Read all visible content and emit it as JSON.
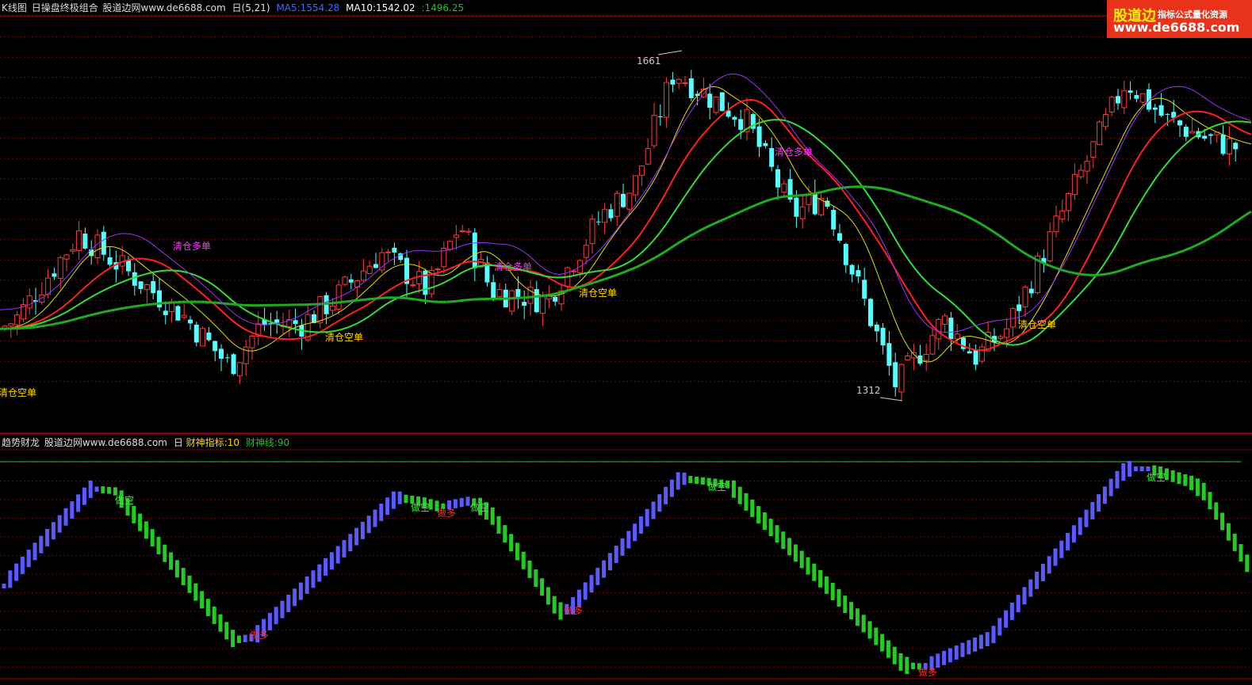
{
  "main_panel": {
    "title": "K线图",
    "formula_name": "日操盘终极组合",
    "site_text": "股道边网www.de6688.com",
    "period": "日(5,21)",
    "ma5_text": "MA5:1554.28",
    "ma10_text": "MA10:1542.02",
    "ma_long_text": ":1496.25",
    "colors": {
      "ma5": "#3a6bff",
      "ma10": "#ffffff",
      "ma_long": "#22c022",
      "bull": "#ff3a3a",
      "bear": "#54ffff",
      "grid": "#7a0000"
    },
    "high_label": "1661",
    "low_label": "1312",
    "labels": [
      {
        "text": "清仓空单",
        "color": "#ffd800",
        "id": "a1"
      },
      {
        "text": "清仓多单",
        "color": "#ff33ff",
        "id": "a2"
      },
      {
        "text": "清仓空单",
        "color": "#ffd800",
        "id": "a3"
      },
      {
        "text": "清仓多单",
        "color": "#ff33ff",
        "id": "a4"
      },
      {
        "text": "清仓空单",
        "color": "#ffd800",
        "id": "a5"
      },
      {
        "text": "清仓多单",
        "color": "#ff33ff",
        "id": "a6"
      },
      {
        "text": "清仓空单",
        "color": "#ffd800",
        "id": "a7"
      }
    ]
  },
  "sub_panel": {
    "title": "趋势财龙",
    "site_text": "股道边网www.de6688.com",
    "period": "日",
    "indicator_text": "财神指标:10",
    "line_text": "财神线:90",
    "signals": [
      {
        "text": "做空",
        "type": "short"
      },
      {
        "text": "做多",
        "type": "long"
      },
      {
        "text": "做空",
        "type": "short"
      },
      {
        "text": "做多",
        "type": "long"
      },
      {
        "text": "做空",
        "type": "short"
      },
      {
        "text": "做多",
        "type": "long"
      },
      {
        "text": "做空",
        "type": "short"
      },
      {
        "text": "做多",
        "type": "long"
      },
      {
        "text": "做空",
        "type": "short"
      }
    ]
  },
  "logo": {
    "brand": "股道边",
    "tagline": "指标公式量化资源",
    "url": "www.de6688.com"
  },
  "chart_data": {
    "type": "candlestick",
    "series": [
      {
        "name": "MA5",
        "value": 1554.28
      },
      {
        "name": "MA10",
        "value": 1542.02
      },
      {
        "name": "",
        "value": 1496.25
      }
    ],
    "price_high": 1661,
    "price_low": 1312,
    "indicator": {
      "name": "财神指标",
      "value": 10
    },
    "indicator_line": {
      "name": "财神线",
      "value": 90
    }
  }
}
